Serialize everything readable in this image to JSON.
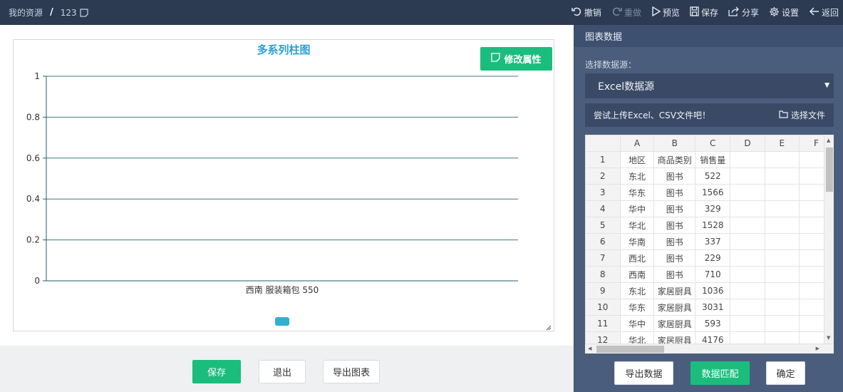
{
  "breadcrumb": {
    "root": "我的资源",
    "separator": "/",
    "current": "123"
  },
  "toolbar": {
    "undo": "撤销",
    "redo": "重做",
    "preview": "预览",
    "save": "保存",
    "share": "分享",
    "settings": "设置",
    "back": "返回"
  },
  "chart_panel": {
    "modify_button": "修改属性"
  },
  "chart_data": {
    "type": "bar",
    "title": "多系列柱图",
    "categories": [
      "西南 服装箱包 550"
    ],
    "series": [],
    "ylim": [
      0,
      1
    ],
    "y_ticks": [
      "0",
      "0.2",
      "0.4",
      "0.6",
      "0.8",
      "1"
    ],
    "y_tick_values": [
      0,
      0.2,
      0.4,
      0.6,
      0.8,
      1
    ],
    "grid": true,
    "legend_position": "bottom",
    "legend_color": "#2fb1cf",
    "axis_color": "#1f5f6e"
  },
  "footer": {
    "save": "保存",
    "exit": "退出",
    "export_chart": "导出图表"
  },
  "data_panel": {
    "title": "图表数据",
    "source_label": "选择数据源：",
    "source_value": "Excel数据源",
    "upload_hint": "尝试上传Excel、CSV文件吧！",
    "choose_file": "选择文件",
    "col_headers": [
      "",
      "A",
      "B",
      "C",
      "D",
      "E",
      "F"
    ],
    "rows": [
      [
        "1",
        "地区",
        "商品类别",
        "销售量",
        "",
        ""
      ],
      [
        "2",
        "东北",
        "图书",
        "522",
        "",
        ""
      ],
      [
        "3",
        "华东",
        "图书",
        "1566",
        "",
        ""
      ],
      [
        "4",
        "华中",
        "图书",
        "329",
        "",
        ""
      ],
      [
        "5",
        "华北",
        "图书",
        "1528",
        "",
        ""
      ],
      [
        "6",
        "华南",
        "图书",
        "337",
        "",
        ""
      ],
      [
        "7",
        "西北",
        "图书",
        "229",
        "",
        ""
      ],
      [
        "8",
        "西南",
        "图书",
        "710",
        "",
        ""
      ],
      [
        "9",
        "东北",
        "家居厨具",
        "1036",
        "",
        ""
      ],
      [
        "10",
        "华东",
        "家居厨具",
        "3031",
        "",
        ""
      ],
      [
        "11",
        "华中",
        "家居厨具",
        "593",
        "",
        ""
      ],
      [
        "12",
        "华北",
        "家居厨具",
        "4176",
        "",
        ""
      ]
    ],
    "export_data": "导出数据",
    "match_data": "数据匹配",
    "confirm": "确定"
  },
  "colors": {
    "topbar": "#2c3a52",
    "accent_green": "#1bbd7d",
    "panel_bg": "#4a5d7c",
    "title_blue": "#2a9fd6"
  }
}
